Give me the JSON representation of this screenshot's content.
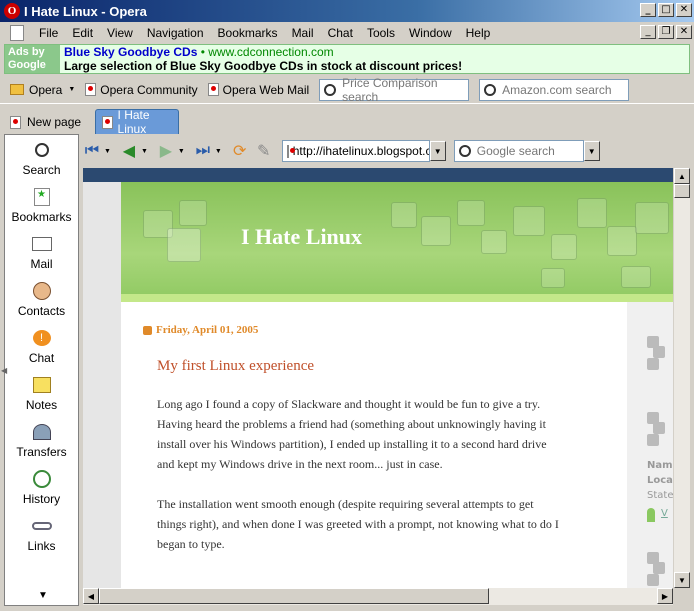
{
  "window": {
    "title": "I Hate Linux - Opera"
  },
  "menu": [
    "File",
    "Edit",
    "View",
    "Navigation",
    "Bookmarks",
    "Mail",
    "Chat",
    "Tools",
    "Window",
    "Help"
  ],
  "ad": {
    "label": "Ads by Google",
    "title": "Blue Sky Goodbye CDs",
    "url": "www.cdconnection.com",
    "description": "Large selection of Blue Sky Goodbye CDs in stock at discount prices!"
  },
  "personal_bar": {
    "items": [
      "Opera",
      "Opera Community",
      "Opera Web Mail"
    ],
    "search1_placeholder": "Price Comparison search",
    "search2_placeholder": "Amazon.com search"
  },
  "tabs": {
    "new_page": "New page",
    "active_tab": "I Hate Linux"
  },
  "panel": [
    "Search",
    "Bookmarks",
    "Mail",
    "Contacts",
    "Chat",
    "Notes",
    "Transfers",
    "History",
    "Links"
  ],
  "nav": {
    "address": "http://ihatelinux.blogspot.com",
    "search_placeholder": "Google search"
  },
  "blog": {
    "title": "I Hate Linux",
    "date": "Friday, April 01, 2005",
    "post_title": "My first Linux experience",
    "para1_lines": [
      "Long ago I found a copy of Slackware and thought it would be fun to give a try.",
      "Having heard the problems a friend had (something about unknowingly having it",
      "install over his Windows partition), I ended up installing it to a second hard drive",
      "and kept my Windows drive in the next room... just in case."
    ],
    "para2_lines": [
      "The installation went smooth enough (despite requiring several attempts to get",
      "things right), and when done I was greeted with a prompt, not knowing what to do I",
      "began to type."
    ],
    "sidebar_fragments": [
      "Nam",
      "Loca",
      "State",
      "V"
    ]
  },
  "colors": {
    "title_bar": "#0a246a",
    "header_green": "#89c25a",
    "date": "#e08a2a",
    "post_title": "#c0502a"
  }
}
